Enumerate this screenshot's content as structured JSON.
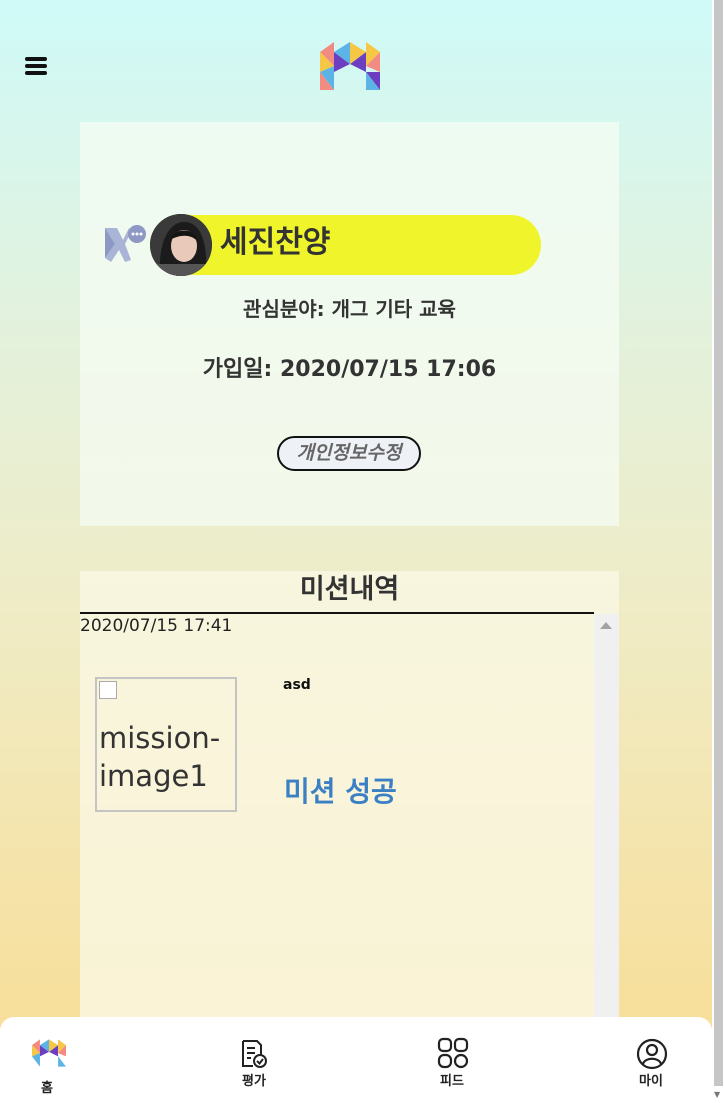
{
  "header": {
    "menu_icon": "hamburger-menu-icon",
    "logo_icon": "m-logo-icon"
  },
  "profile": {
    "badge_icon": "ribbon-chat-badge-icon",
    "nickname": "세진찬양",
    "interest": "관심분야: 개그 기타 교육",
    "joined": "가입일: 2020/07/15 17:06",
    "edit_label": "개인정보수정",
    "pill_color": "#eff52a"
  },
  "missions": {
    "title": "미션내역",
    "items": [
      {
        "date": "2020/07/15 17:41",
        "image_alt": "mission-image1",
        "text": "asd",
        "status": "미션 성공",
        "status_color": "#3b7fc4"
      }
    ]
  },
  "bottom_nav": {
    "items": [
      {
        "label": "홈",
        "icon": "home-logo-icon"
      },
      {
        "label": "평가",
        "icon": "evaluation-icon"
      },
      {
        "label": "피드",
        "icon": "feed-grid-icon"
      },
      {
        "label": "마이",
        "icon": "user-icon"
      }
    ]
  }
}
